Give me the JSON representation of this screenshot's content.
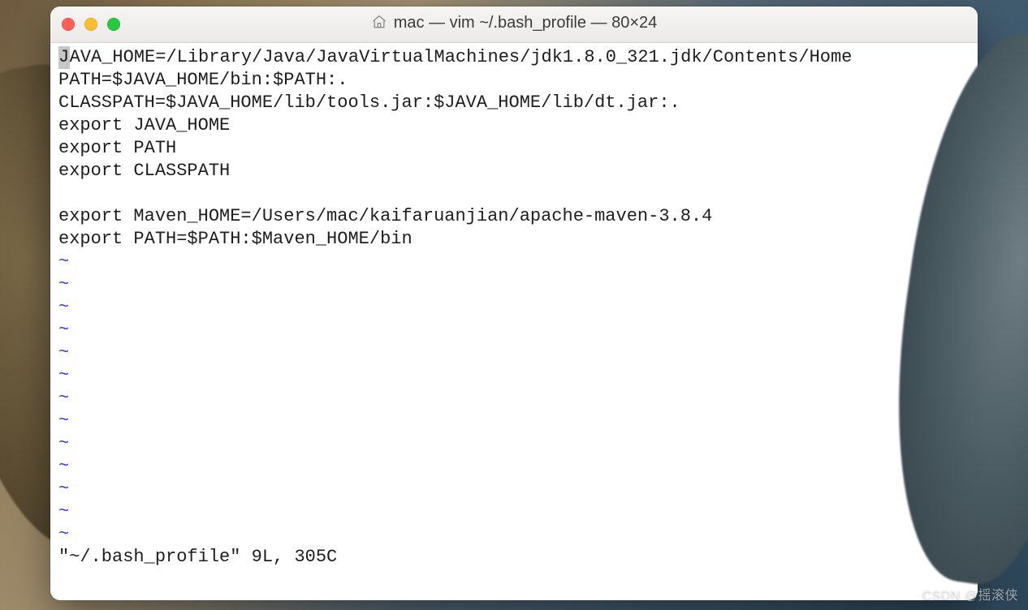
{
  "window": {
    "title": "mac — vim ~/.bash_profile — 80×24"
  },
  "editor": {
    "cursor_char": "J",
    "line1_rest": "AVA_HOME=/Library/Java/JavaVirtualMachines/jdk1.8.0_321.jdk/Contents/Home",
    "lines_after": [
      "PATH=$JAVA_HOME/bin:$PATH:.",
      "CLASSPATH=$JAVA_HOME/lib/tools.jar:$JAVA_HOME/lib/dt.jar:.",
      "export JAVA_HOME",
      "export PATH",
      "export CLASSPATH",
      "",
      "export Maven_HOME=/Users/mac/kaifaruanjian/apache-maven-3.8.4",
      "export PATH=$PATH:$Maven_HOME/bin"
    ],
    "tilde": "~",
    "tilde_count": 13,
    "status": "\"~/.bash_profile\" 9L, 305C"
  },
  "watermark": "CSDN @摇滚侠"
}
